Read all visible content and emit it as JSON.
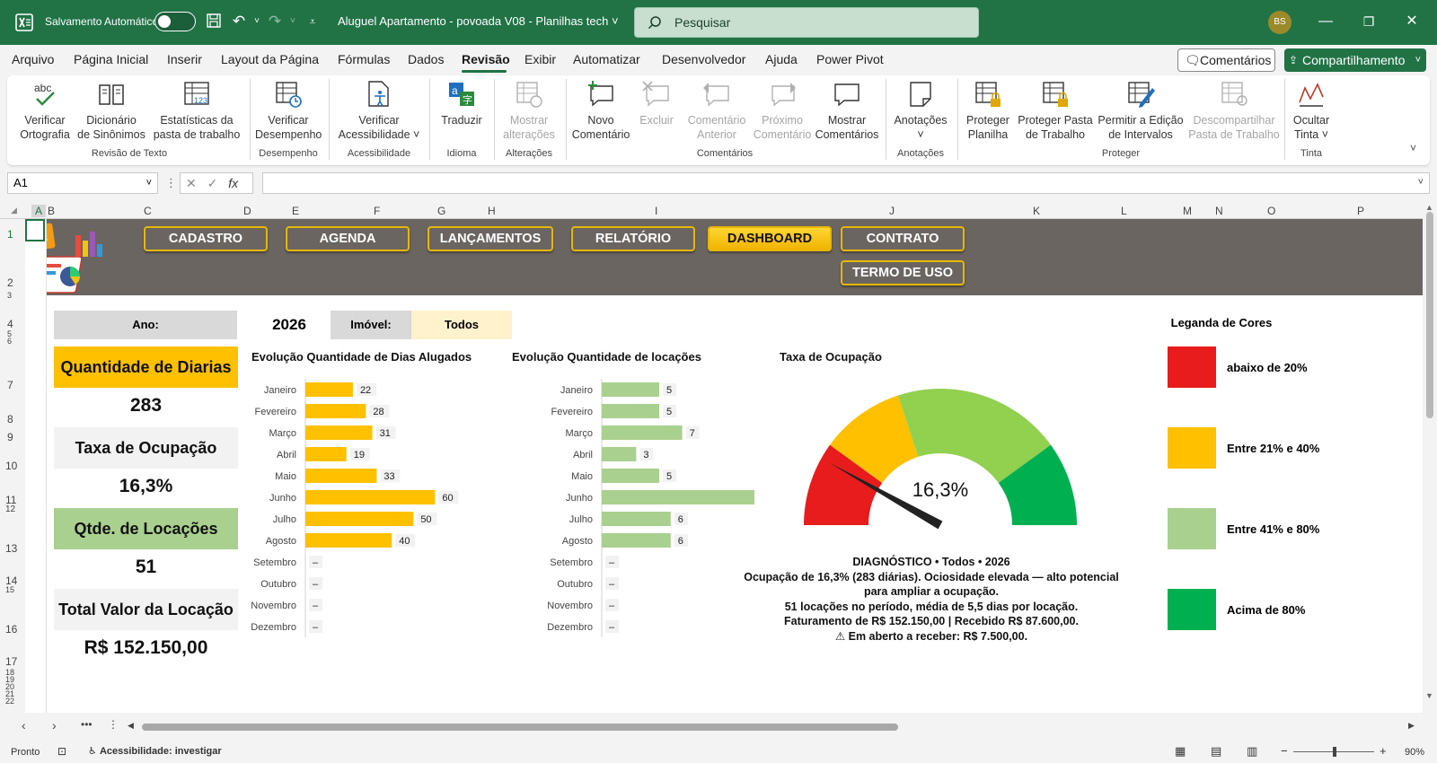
{
  "titlebar": {
    "autosave_label": "Salvamento Automático",
    "document_title": "Aluguel Apartamento - povoada V08 - Planilhas tech",
    "search_placeholder": "Pesquisar",
    "avatar_initials": "BS"
  },
  "menu": {
    "tabs": [
      "Arquivo",
      "Página Inicial",
      "Inserir",
      "Layout da Página",
      "Fórmulas",
      "Dados",
      "Revisão",
      "Exibir",
      "Automatizar",
      "Desenvolvedor",
      "Ajuda",
      "Power Pivot"
    ],
    "active_tab": "Revisão",
    "comments_button": "Comentários",
    "share_button": "Compartilhamento"
  },
  "ribbon": {
    "buttons": [
      {
        "line1": "Verificar",
        "line2": "Ortografia",
        "enabled": true
      },
      {
        "line1": "Dicionário",
        "line2": "de Sinônimos",
        "enabled": true
      },
      {
        "line1": "Estatísticas da",
        "line2": "pasta de trabalho",
        "enabled": true
      },
      {
        "line1": "Verificar",
        "line2": "Desempenho",
        "enabled": true
      },
      {
        "line1": "Verificar",
        "line2": "Acessibilidade ˅",
        "enabled": true
      },
      {
        "line1": "Traduzir",
        "line2": "",
        "enabled": true
      },
      {
        "line1": "Mostrar",
        "line2": "alterações",
        "enabled": false
      },
      {
        "line1": "Novo",
        "line2": "Comentário",
        "enabled": true
      },
      {
        "line1": "Excluir",
        "line2": "",
        "enabled": false
      },
      {
        "line1": "Comentário",
        "line2": "Anterior",
        "enabled": false
      },
      {
        "line1": "Próximo",
        "line2": "Comentário",
        "enabled": false
      },
      {
        "line1": "Mostrar",
        "line2": "Comentários",
        "enabled": true
      },
      {
        "line1": "Anotações",
        "line2": "˅",
        "enabled": true
      },
      {
        "line1": "Proteger",
        "line2": "Planilha",
        "enabled": true
      },
      {
        "line1": "Proteger Pasta",
        "line2": "de Trabalho",
        "enabled": true
      },
      {
        "line1": "Permitir a Edição",
        "line2": "de Intervalos",
        "enabled": true
      },
      {
        "line1": "Descompartilhar",
        "line2": "Pasta de Trabalho",
        "enabled": false
      },
      {
        "line1": "Ocultar",
        "line2": "Tinta ˅",
        "enabled": true
      }
    ],
    "groups": [
      "Revisão de Texto",
      "Desempenho",
      "Acessibilidade",
      "Idioma",
      "Alterações",
      "Comentários",
      "Anotações",
      "Proteger",
      "Tinta"
    ]
  },
  "formula_bar": {
    "name_box": "A1",
    "fx": "fx",
    "formula": ""
  },
  "grid": {
    "columns": [
      "A",
      "B",
      "C",
      "D",
      "E",
      "F",
      "G",
      "H",
      "I",
      "J",
      "K",
      "L",
      "M",
      "N",
      "O",
      "P"
    ],
    "rows": [
      "1",
      "2",
      "3",
      "4",
      "5",
      "6",
      "7",
      "8",
      "9",
      "10",
      "11",
      "12",
      "13",
      "14",
      "15",
      "16",
      "17",
      "18",
      "19",
      "20",
      "21",
      "22"
    ]
  },
  "nav": {
    "buttons": [
      "CADASTRO",
      "AGENDA",
      "LANÇAMENTOS",
      "RELATÓRIO",
      "DASHBOARD",
      "CONTRATO",
      "TERMO DE USO"
    ],
    "active": "DASHBOARD"
  },
  "filters": {
    "year_label": "Ano:",
    "year_value": "2026",
    "property_label": "Imóvel:",
    "property_value": "Todos"
  },
  "kpis": [
    {
      "title": "Quantidade de Diarias",
      "value": "283",
      "color": "#ffc000"
    },
    {
      "title": "Taxa de Ocupação",
      "value": "16,3%",
      "color": "#f2f2f2"
    },
    {
      "title": "Qtde. de Locações",
      "value": "51",
      "color": "#a9d08e"
    },
    {
      "title": "Total Valor da Locação",
      "value": "R$ 152.150,00",
      "color": "#f2f2f2"
    }
  ],
  "chart_data": [
    {
      "type": "bar",
      "title": "Evolução Quantidade de Dias Alugados",
      "categories": [
        "Janeiro",
        "Fevereiro",
        "Março",
        "Abril",
        "Maio",
        "Junho",
        "Julho",
        "Agosto",
        "Setembro",
        "Outubro",
        "Novembro",
        "Dezembro"
      ],
      "values": [
        22,
        28,
        31,
        19,
        33,
        60,
        50,
        40,
        0,
        0,
        0,
        0
      ],
      "labels": [
        "22",
        "28",
        "31",
        "19",
        "33",
        "60",
        "50",
        "40",
        "–",
        "–",
        "–",
        "–"
      ],
      "color": "#ffc000",
      "max": 64
    },
    {
      "type": "bar",
      "title": "Evolução Quantidade de locações",
      "categories": [
        "Janeiro",
        "Fevereiro",
        "Março",
        "Abril",
        "Maio",
        "Junho",
        "Julho",
        "Agosto",
        "Setembro",
        "Outubro",
        "Novembro",
        "Dezembro"
      ],
      "values": [
        5,
        5,
        7,
        3,
        5,
        14,
        6,
        6,
        0,
        0,
        0,
        0
      ],
      "labels": [
        "5",
        "5",
        "7",
        "3",
        "5",
        "14",
        "6",
        "6",
        "–",
        "–",
        "–",
        "–"
      ],
      "color": "#a9d08e",
      "max": 15
    },
    {
      "type": "gauge",
      "title": "Taxa de Ocupação",
      "value": 16.3,
      "display": "16,3%",
      "bands": [
        {
          "from": 0,
          "to": 20,
          "color": "#e81c1c"
        },
        {
          "from": 20,
          "to": 40,
          "color": "#ffc000"
        },
        {
          "from": 40,
          "to": 80,
          "color": "#92d050"
        },
        {
          "from": 80,
          "to": 100,
          "color": "#00b050"
        }
      ]
    }
  ],
  "diagnostico": {
    "line1": "DIAGNÓSTICO • Todos • 2026",
    "line2": "Ocupação de 16,3% (283 diárias). Ociosidade elevada — alto potencial",
    "line3": "para ampliar a ocupação.",
    "line4": "51 locações no período, média de 5,5 dias por locação.",
    "line5": "Faturamento de R$ 152.150,00 | Recebido R$ 87.600,00.",
    "line6": "⚠ Em aberto a receber: R$ 7.500,00."
  },
  "legend": {
    "title": "Leganda de Cores",
    "items": [
      {
        "label": "abaixo de 20%",
        "color": "#e81c1c"
      },
      {
        "label": "Entre 21% e 40%",
        "color": "#ffc000"
      },
      {
        "label": "Entre 41% e 80%",
        "color": "#a9d08e"
      },
      {
        "label": "Acima de 80%",
        "color": "#00b050"
      }
    ]
  },
  "status": {
    "ready": "Pronto",
    "accessibility": "Acessibilidade: investigar",
    "zoom": "90%"
  }
}
